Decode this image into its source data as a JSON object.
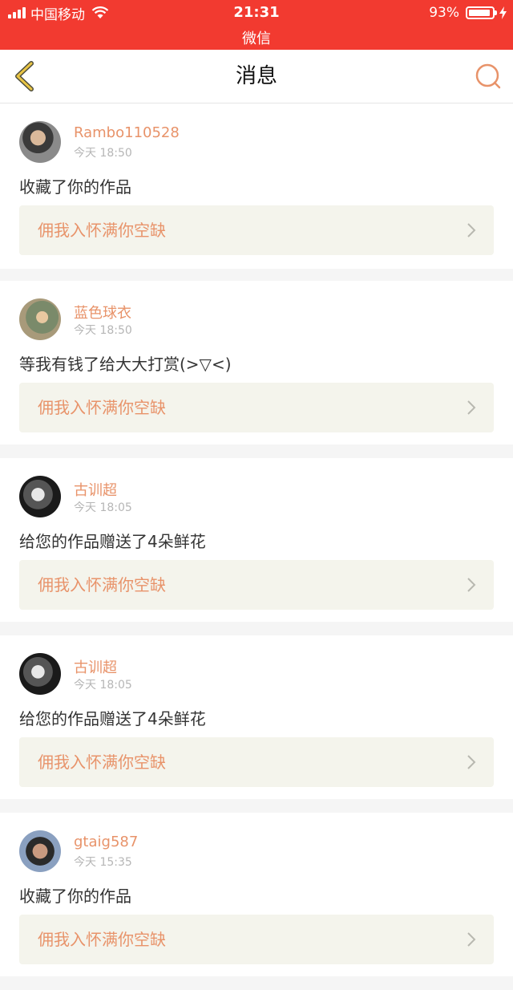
{
  "status_bar": {
    "carrier": "中国移动",
    "time": "21:31",
    "battery": "93%",
    "battery_level": 0.93,
    "app_name": "微信"
  },
  "nav": {
    "title": "消息",
    "back_icon": "chevron-left-icon",
    "search_icon": "search-icon"
  },
  "colors": {
    "status_bar_bg": "#f23a30",
    "accent": "#e8936a",
    "card_inner_bg": "#f4f4ec"
  },
  "messages": [
    {
      "user": "Rambo110528",
      "time": "今天 18:50",
      "text": "收藏了你的作品",
      "work_title": "佣我入怀满你空缺"
    },
    {
      "user": "蓝色球衣",
      "time": "今天 18:50",
      "text": "等我有钱了给大大打赏(>▽<)",
      "work_title": "佣我入怀满你空缺"
    },
    {
      "user": "古训超",
      "time": "今天 18:05",
      "text": "给您的作品赠送了4朵鲜花",
      "work_title": "佣我入怀满你空缺"
    },
    {
      "user": "古训超",
      "time": "今天 18:05",
      "text": "给您的作品赠送了4朵鲜花",
      "work_title": "佣我入怀满你空缺"
    },
    {
      "user": "gtaig587",
      "time": "今天 15:35",
      "text": "收藏了你的作品",
      "work_title": "佣我入怀满你空缺"
    }
  ]
}
